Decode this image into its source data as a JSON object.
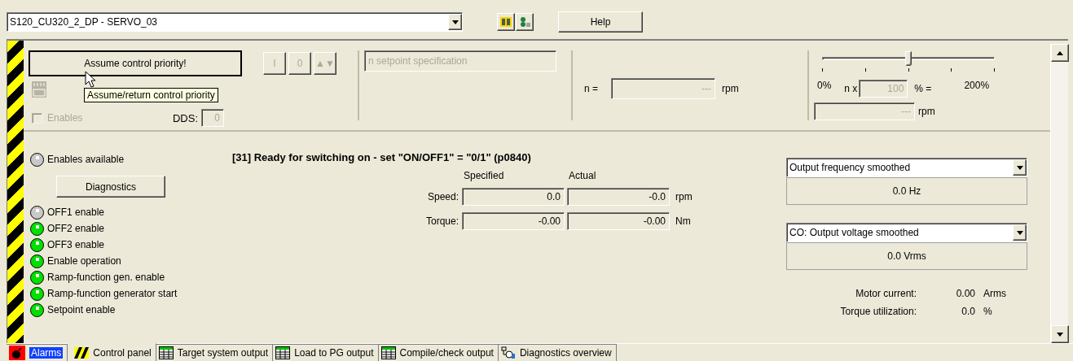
{
  "object_selector": {
    "value": "S120_CU320_2_DP - SERVO_03"
  },
  "help_button": "Help",
  "control": {
    "assume_button": "Assume control priority!",
    "tooltip": "Assume/return control priority",
    "buttons": [
      "I",
      "0",
      "▲▼"
    ],
    "enables": {
      "label": "Enables",
      "checked": false,
      "disabled": true
    },
    "dds": {
      "label": "DDS:",
      "value": "0"
    }
  },
  "setpoint": {
    "placeholder": "n setpoint specification"
  },
  "n_display": {
    "label": "n =",
    "value": "---",
    "unit": "rpm"
  },
  "override": {
    "level": 0.5,
    "min": "0%",
    "max": "200%",
    "n_label": "n x",
    "value": "100",
    "percent": "% =",
    "result": "---",
    "unit": "rpm"
  },
  "enables_available": {
    "label": "Enables available",
    "on": false
  },
  "diagnostics_button": "Diagnostics",
  "enable_signals": [
    {
      "label": "OFF1 enable",
      "on": false
    },
    {
      "label": "OFF2 enable",
      "on": true
    },
    {
      "label": "OFF3 enable",
      "on": true
    },
    {
      "label": "Enable operation",
      "on": true
    },
    {
      "label": "Ramp-function gen. enable",
      "on": true
    },
    {
      "label": "Ramp-function generator start",
      "on": true
    },
    {
      "label": "Setpoint enable",
      "on": true
    }
  ],
  "status_message": "[31] Ready for switching on - set \"ON/OFF1\" = \"0/1\" (p0840)",
  "values_table": {
    "columns": [
      "Specified",
      "Actual"
    ],
    "rows": [
      {
        "label": "Speed:",
        "specified": "0.0",
        "actual": "-0.0",
        "unit": "rpm"
      },
      {
        "label": "Torque:",
        "specified": "-0.00",
        "actual": "-0.00",
        "unit": "Nm"
      }
    ]
  },
  "monitors": [
    {
      "signal": "Output frequency smoothed",
      "value": "0.0 Hz"
    },
    {
      "signal": "CO: Output voltage smoothed",
      "value": "0.0 Vrms"
    }
  ],
  "readings": [
    {
      "label": "Motor current:",
      "value": "0.00",
      "unit": "Arms"
    },
    {
      "label": "Torque utilization:",
      "value": "0.0",
      "unit": "%"
    }
  ],
  "tabs": [
    {
      "label": "Alarms",
      "kind": "alarm",
      "alert": true,
      "selected": false
    },
    {
      "label": "Control panel",
      "kind": "hazard",
      "alert": false,
      "selected": true
    },
    {
      "label": "Target system output",
      "kind": "table",
      "alert": false,
      "selected": false
    },
    {
      "label": "Load to PG output",
      "kind": "table",
      "alert": false,
      "selected": false
    },
    {
      "label": "Compile/check output",
      "kind": "table",
      "alert": false,
      "selected": false
    },
    {
      "label": "Diagnostics overview",
      "kind": "network",
      "alert": false,
      "selected": false
    }
  ]
}
